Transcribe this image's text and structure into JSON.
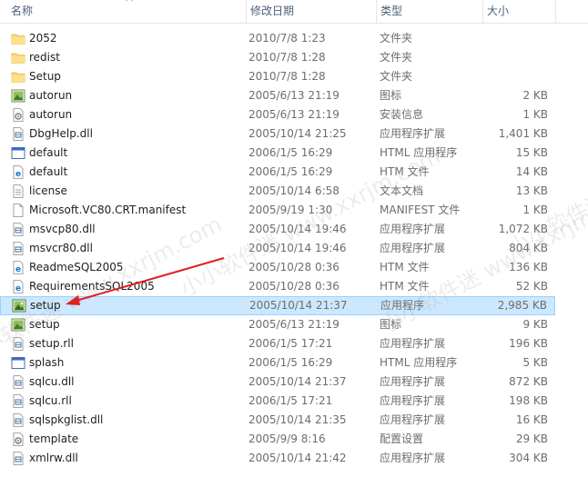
{
  "columns": {
    "name": "名称",
    "date": "修改日期",
    "type": "类型",
    "size": "大小"
  },
  "files": [
    {
      "icon": "folder",
      "name": "2052",
      "date": "2010/7/8 1:23",
      "type": "文件夹",
      "size": ""
    },
    {
      "icon": "folder",
      "name": "redist",
      "date": "2010/7/8 1:28",
      "type": "文件夹",
      "size": ""
    },
    {
      "icon": "folder",
      "name": "Setup",
      "date": "2010/7/8 1:28",
      "type": "文件夹",
      "size": ""
    },
    {
      "icon": "image",
      "name": "autorun",
      "date": "2005/6/13 21:19",
      "type": "图标",
      "size": "2 KB"
    },
    {
      "icon": "settings-file",
      "name": "autorun",
      "date": "2005/6/13 21:19",
      "type": "安装信息",
      "size": "1 KB"
    },
    {
      "icon": "dll",
      "name": "DbgHelp.dll",
      "date": "2005/10/14 21:25",
      "type": "应用程序扩展",
      "size": "1,401 KB"
    },
    {
      "icon": "hta",
      "name": "default",
      "date": "2006/1/5 16:29",
      "type": "HTML 应用程序",
      "size": "15 KB"
    },
    {
      "icon": "htm",
      "name": "default",
      "date": "2006/1/5 16:29",
      "type": "HTM 文件",
      "size": "14 KB"
    },
    {
      "icon": "text",
      "name": "license",
      "date": "2005/10/14 6:58",
      "type": "文本文档",
      "size": "13 KB"
    },
    {
      "icon": "blank",
      "name": "Microsoft.VC80.CRT.manifest",
      "date": "2005/9/19 1:30",
      "type": "MANIFEST 文件",
      "size": "1 KB"
    },
    {
      "icon": "dll",
      "name": "msvcp80.dll",
      "date": "2005/10/14 19:46",
      "type": "应用程序扩展",
      "size": "1,072 KB"
    },
    {
      "icon": "dll",
      "name": "msvcr80.dll",
      "date": "2005/10/14 19:46",
      "type": "应用程序扩展",
      "size": "804 KB"
    },
    {
      "icon": "htm",
      "name": "ReadmeSQL2005",
      "date": "2005/10/28 0:36",
      "type": "HTM 文件",
      "size": "136 KB"
    },
    {
      "icon": "htm",
      "name": "RequirementsSQL2005",
      "date": "2005/10/28 0:36",
      "type": "HTM 文件",
      "size": "52 KB"
    },
    {
      "icon": "setup-exe",
      "name": "setup",
      "date": "2005/10/14 21:37",
      "type": "应用程序",
      "size": "2,985 KB",
      "selected": true
    },
    {
      "icon": "image",
      "name": "setup",
      "date": "2005/6/13 21:19",
      "type": "图标",
      "size": "9 KB"
    },
    {
      "icon": "dll",
      "name": "setup.rll",
      "date": "2006/1/5 17:21",
      "type": "应用程序扩展",
      "size": "196 KB"
    },
    {
      "icon": "hta",
      "name": "splash",
      "date": "2006/1/5 16:29",
      "type": "HTML 应用程序",
      "size": "5 KB"
    },
    {
      "icon": "dll",
      "name": "sqlcu.dll",
      "date": "2005/10/14 21:37",
      "type": "应用程序扩展",
      "size": "872 KB"
    },
    {
      "icon": "dll",
      "name": "sqlcu.rll",
      "date": "2006/1/5 17:21",
      "type": "应用程序扩展",
      "size": "198 KB"
    },
    {
      "icon": "dll",
      "name": "sqlspkglist.dll",
      "date": "2005/10/14 21:35",
      "type": "应用程序扩展",
      "size": "16 KB"
    },
    {
      "icon": "settings-file",
      "name": "template",
      "date": "2005/9/9 8:16",
      "type": "配置设置",
      "size": "29 KB"
    },
    {
      "icon": "dll",
      "name": "xmlrw.dll",
      "date": "2005/10/14 21:42",
      "type": "应用程序扩展",
      "size": "304 KB"
    }
  ],
  "watermark": "小小软件迷 www.xxrjm.com",
  "colors": {
    "selected_bg": "#cce8ff",
    "selected_border": "#99d1ff",
    "folder": "#f7d674",
    "arrow": "#e02020"
  }
}
